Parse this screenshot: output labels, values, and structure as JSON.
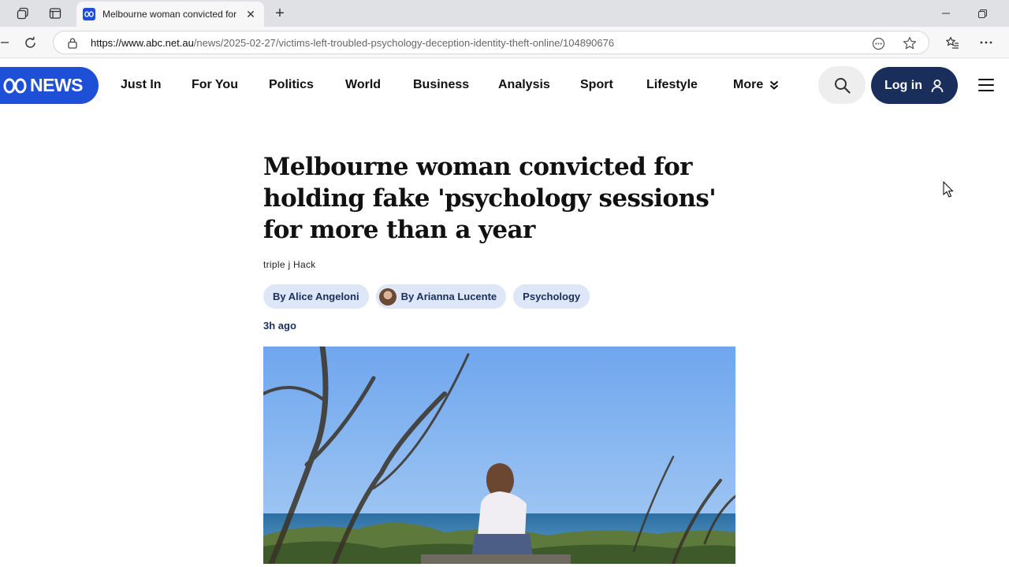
{
  "browser": {
    "tab_title": "Melbourne woman convicted for fake 'psychology sessions'",
    "tab_favicon": "ABC",
    "url_host": "https://www.abc.net.au",
    "url_path": "/news/2025-02-27/victims-left-troubled-psychology-deception-identity-theft-online/104890676"
  },
  "site": {
    "logo_text": "NEWS",
    "nav": [
      "Just In",
      "For You",
      "Politics",
      "World",
      "Business",
      "Analysis",
      "Sport",
      "Lifestyle",
      "More"
    ],
    "login_label": "Log in"
  },
  "article": {
    "headline": "Melbourne woman convicted for holding fake 'psychology sessions' for more than a year",
    "source": "triple j Hack",
    "authors": [
      "By Alice Angeloni",
      "By Arianna Lucente"
    ],
    "topic": "Psychology",
    "time": "3h ago",
    "image_alt": "woman sitting by the sea"
  },
  "colors": {
    "brand": "#1d4fd7",
    "login_bg": "#1a2e5c",
    "pill_bg": "#dde7f7"
  }
}
